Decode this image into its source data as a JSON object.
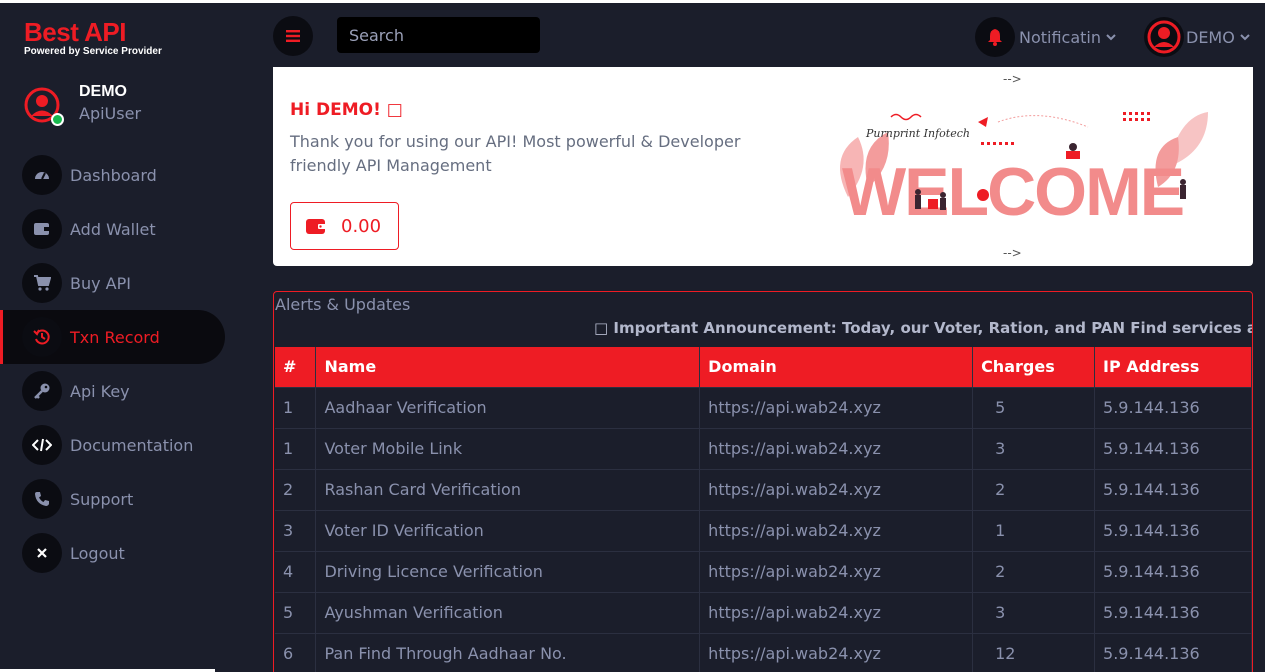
{
  "brand": {
    "title": "Best API",
    "subtitle": "Powered by Service Provider"
  },
  "user": {
    "name": "DEMO",
    "role": "ApiUser"
  },
  "nav": [
    {
      "label": "Dashboard",
      "icon": "dashboard-gauge-icon"
    },
    {
      "label": "Add Wallet",
      "icon": "wallet-icon"
    },
    {
      "label": "Buy API",
      "icon": "cart-icon"
    },
    {
      "label": "Txn Record",
      "icon": "history-icon",
      "active": true
    },
    {
      "label": "Api Key",
      "icon": "key-icon"
    },
    {
      "label": "Documentation",
      "icon": "code-icon"
    },
    {
      "label": "Support",
      "icon": "phone-icon"
    },
    {
      "label": "Logout",
      "icon": "close-icon"
    }
  ],
  "topbar": {
    "search_placeholder": "Search",
    "notification_label": "Notificatin",
    "user_label": "DEMO"
  },
  "welcome": {
    "greeting": "Hi DEMO! □",
    "message": "Thank you for using our API! Most powerful & Developer friendly API Management",
    "wallet_amount": "0.00",
    "arrow_top": "-->",
    "arrow_bottom": "-->",
    "art_word": "WELCOME",
    "art_signature": "Purnprint Infotech"
  },
  "alerts": {
    "title": "Alerts & Updates",
    "announcement": "□ Important Announcement: Today, our Voter, Ration, and PAN Find services are operational"
  },
  "table": {
    "headers": [
      "#",
      "Name",
      "Domain",
      "Charges",
      "IP Address"
    ],
    "rows": [
      [
        "1",
        "Aadhaar Verification",
        "https://api.wab24.xyz",
        "5",
        "5.9.144.136"
      ],
      [
        "1",
        "Voter Mobile Link",
        "https://api.wab24.xyz",
        "3",
        "5.9.144.136"
      ],
      [
        "2",
        "Rashan Card Verification",
        "https://api.wab24.xyz",
        "2",
        "5.9.144.136"
      ],
      [
        "3",
        "Voter ID Verification",
        "https://api.wab24.xyz",
        "1",
        "5.9.144.136"
      ],
      [
        "4",
        "Driving Licence Verification",
        "https://api.wab24.xyz",
        "2",
        "5.9.144.136"
      ],
      [
        "5",
        "Ayushman Verification",
        "https://api.wab24.xyz",
        "3",
        "5.9.144.136"
      ],
      [
        "6",
        "Pan Find Through Aadhaar No.",
        "https://api.wab24.xyz",
        "12",
        "5.9.144.136"
      ]
    ]
  },
  "colors": {
    "accent": "#ee1c24",
    "background": "#1b1e2b",
    "muted_text": "#8a91ad"
  }
}
